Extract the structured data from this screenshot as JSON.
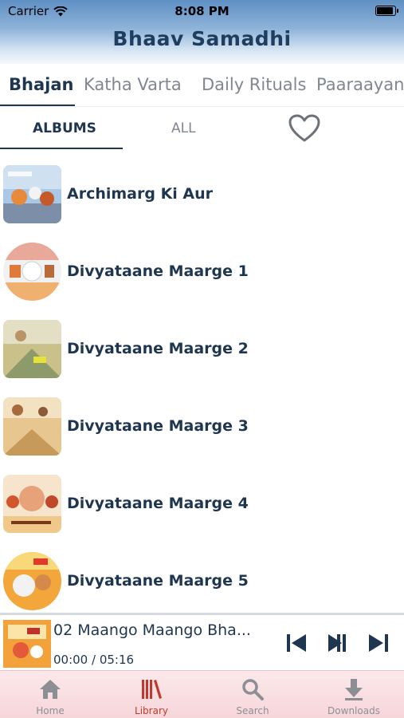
{
  "status_bar": {
    "carrier": "Carrier",
    "time": "8:08 PM"
  },
  "header": {
    "title": "Bhaav Samadhi"
  },
  "top_tabs": [
    {
      "label": "Bhajan",
      "active": true
    },
    {
      "label": "Katha Varta",
      "active": false
    },
    {
      "label": "Daily Rituals",
      "active": false
    },
    {
      "label": "Paaraayan",
      "active": false
    }
  ],
  "sub_tabs": [
    {
      "label": "ALBUMS",
      "active": true
    },
    {
      "label": "ALL",
      "active": false
    }
  ],
  "favorites_icon": "heart-icon",
  "albums": [
    {
      "title": "Archimarg Ki Aur"
    },
    {
      "title": "Divyataane Maarge 1"
    },
    {
      "title": "Divyataane Maarge 2"
    },
    {
      "title": "Divyataane Maarge 3"
    },
    {
      "title": "Divyataane Maarge 4"
    },
    {
      "title": "Divyataane Maarge 5"
    }
  ],
  "player": {
    "track_title": "02 Maango Maango Bha...",
    "time": "00:00 / 05:16",
    "controls": [
      "skip-previous-icon",
      "play-pause-icon",
      "skip-next-icon"
    ]
  },
  "bottom_nav": [
    {
      "label": "Home",
      "icon": "home-icon",
      "active": false
    },
    {
      "label": "Library",
      "icon": "library-icon",
      "active": true
    },
    {
      "label": "Search",
      "icon": "search-icon",
      "active": false
    },
    {
      "label": "Downloads",
      "icon": "download-icon",
      "active": false
    }
  ],
  "colors": {
    "primary_text": "#1f3650",
    "inactive_text": "#7f8790",
    "nav_active": "#c0392b",
    "header_top": "#5f8fc4"
  }
}
